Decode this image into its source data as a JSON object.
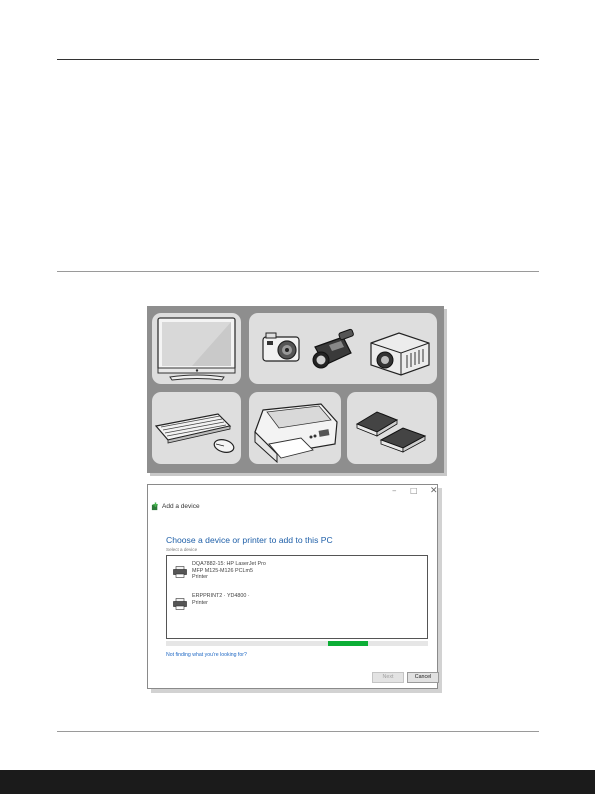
{
  "dialog": {
    "title": "Add a device",
    "controls": {
      "minimize": "–",
      "maximize": "□",
      "close": "✕"
    },
    "heading": "Choose a device or printer to add to this PC",
    "select_label": "Select a device",
    "devices": [
      {
        "lines": [
          "DQA7882-15: HP LaserJet Pro",
          "MFP M125-M126 PCLm5",
          "Printer"
        ],
        "icon": "printer-icon"
      },
      {
        "lines": [
          "ERPPRINT2 · YD4800 ·",
          "Printer"
        ],
        "icon": "printer-icon"
      }
    ],
    "progress": 0.15,
    "help_link": "Not finding what you're looking for?",
    "next_label": "Next",
    "cancel_label": "Cancel"
  },
  "illustration": {
    "tiles": [
      "monitor-icon",
      "camera-icon",
      "camcorder-icon",
      "projector-icon",
      "keyboard-icon",
      "mouse-icon",
      "printer-icon",
      "memory-card-icon"
    ]
  },
  "colors": {
    "heading_blue": "#1e5fa8",
    "link_blue": "#1f68c4",
    "progress_green": "#0cae36",
    "panel_gray": "#8e8e8e",
    "footer_bar": "#1b1b1b"
  }
}
